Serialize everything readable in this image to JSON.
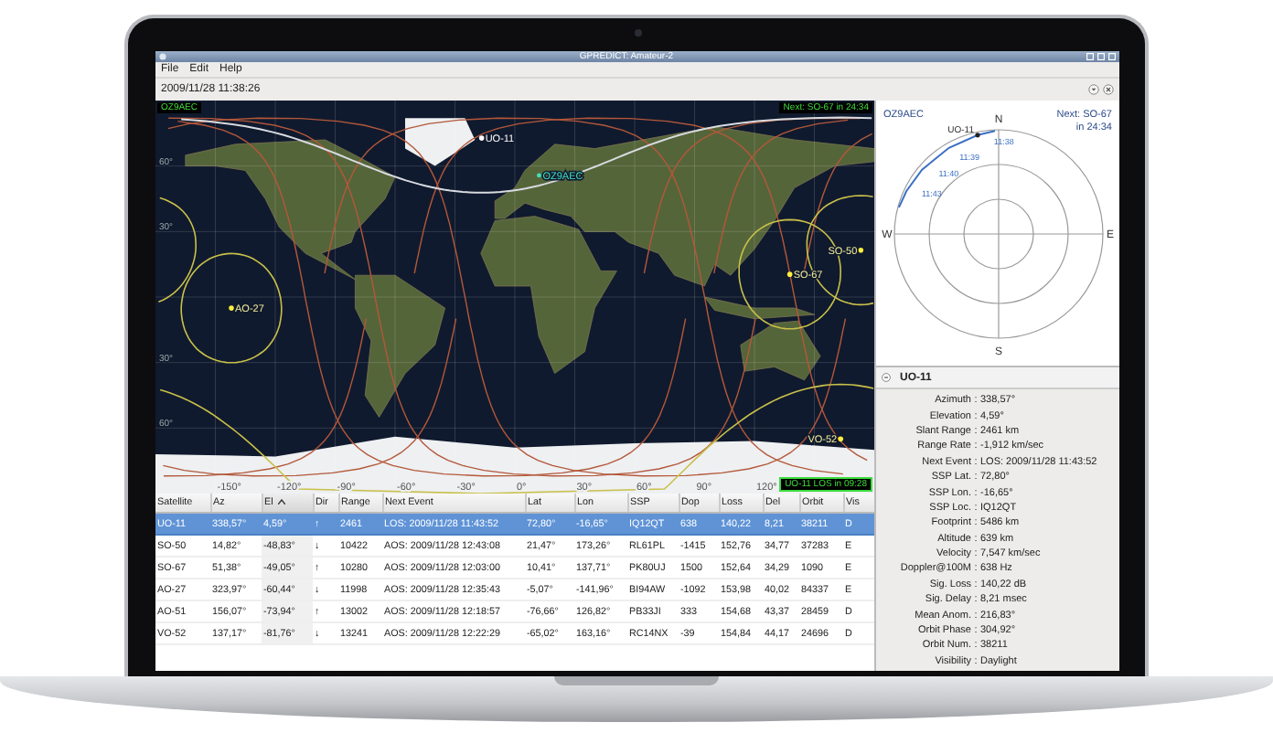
{
  "window": {
    "title": "GPREDICT: Amateur-2"
  },
  "menu": [
    {
      "label": "File"
    },
    {
      "label": "Edit"
    },
    {
      "label": "Help"
    }
  ],
  "clock": "2009/11/28 11:38:26",
  "map": {
    "station_badge": "OZ9AEC",
    "next_event": "Next: SO-67 in 24:34",
    "los_info": "UO-11 LOS in 09:28",
    "station": "OZ9AEC",
    "lat_labels": [
      "60°",
      "30°",
      "30°",
      "60°"
    ],
    "lon_labels": [
      "-150°",
      "-120°",
      "-90°",
      "-60°",
      "-30°",
      "0°",
      "30°",
      "60°",
      "90°",
      "120°"
    ],
    "satellites": [
      {
        "name": "UO-11",
        "selected": true
      },
      {
        "name": "AO-27",
        "selected": false
      },
      {
        "name": "SO-67",
        "selected": false
      },
      {
        "name": "SO-50",
        "selected": false
      },
      {
        "name": "VO-52",
        "selected": false
      }
    ]
  },
  "table": {
    "columns": [
      {
        "label": "Satellite",
        "sorted": false
      },
      {
        "label": "Az",
        "sorted": false
      },
      {
        "label": "El",
        "sorted": true
      },
      {
        "label": "Dir",
        "sorted": false
      },
      {
        "label": "Range",
        "sorted": false
      },
      {
        "label": "Next Event",
        "sorted": false
      },
      {
        "label": "Lat",
        "sorted": false
      },
      {
        "label": "Lon",
        "sorted": false
      },
      {
        "label": "SSP",
        "sorted": false
      },
      {
        "label": "Dop",
        "sorted": false
      },
      {
        "label": "Loss",
        "sorted": false
      },
      {
        "label": "Del",
        "sorted": false
      },
      {
        "label": "Orbit",
        "sorted": false
      },
      {
        "label": "Vis",
        "sorted": false
      }
    ],
    "rows": [
      {
        "selected": true,
        "cells": [
          "UO-11",
          "338,57°",
          "4,59°",
          "↑",
          "2461",
          "LOS: 2009/11/28 11:43:52",
          "72,80°",
          "-16,65°",
          "IQ12QT",
          "638",
          "140,22",
          "8,21",
          "38211",
          "D"
        ]
      },
      {
        "selected": false,
        "cells": [
          "SO-50",
          "14,82°",
          "-48,83°",
          "↓",
          "10422",
          "AOS: 2009/11/28 12:43:08",
          "21,47°",
          "173,26°",
          "RL61PL",
          "-1415",
          "152,76",
          "34,77",
          "37283",
          "E"
        ]
      },
      {
        "selected": false,
        "cells": [
          "SO-67",
          "51,38°",
          "-49,05°",
          "↑",
          "10280",
          "AOS: 2009/11/28 12:03:00",
          "10,41°",
          "137,71°",
          "PK80UJ",
          "1500",
          "152,64",
          "34,29",
          "1090",
          "E"
        ]
      },
      {
        "selected": false,
        "cells": [
          "AO-27",
          "323,97°",
          "-60,44°",
          "↓",
          "11998",
          "AOS: 2009/11/28 12:35:43",
          "-5,07°",
          "-141,96°",
          "BI94AW",
          "-1092",
          "153,98",
          "40,02",
          "84337",
          "E"
        ]
      },
      {
        "selected": false,
        "cells": [
          "AO-51",
          "156,07°",
          "-73,94°",
          "↑",
          "13002",
          "AOS: 2009/11/28 12:18:57",
          "-76,66°",
          "126,82°",
          "PB33JI",
          "333",
          "154,68",
          "43,37",
          "28459",
          "D"
        ]
      },
      {
        "selected": false,
        "cells": [
          "VO-52",
          "137,17°",
          "-81,76°",
          "↓",
          "13241",
          "AOS: 2009/11/28 12:22:29",
          "-65,02°",
          "163,16°",
          "RC14NX",
          "-39",
          "154,84",
          "44,17",
          "24696",
          "D"
        ]
      }
    ]
  },
  "polar": {
    "station": "OZ9AEC",
    "next": "Next: SO-67",
    "next_time": "in 24:34",
    "compass": [
      "N",
      "E",
      "S",
      "W"
    ],
    "time_labels": [
      "11:38",
      "11:39",
      "11:40",
      "11:43"
    ],
    "satellite": "UO-11"
  },
  "details": {
    "title": "UO-11",
    "separator": ":",
    "rows": [
      {
        "label": "Azimuth",
        "value": "338,57°"
      },
      {
        "label": "Elevation",
        "value": "4,59°"
      },
      {
        "label": "Slant Range",
        "value": "2461 km"
      },
      {
        "label": "Range Rate",
        "value": "-1,912 km/sec"
      },
      {
        "label": "Next Event",
        "value": "LOS: 2009/11/28 11:43:52"
      },
      {
        "label": "SSP Lat.",
        "value": "72,80°"
      },
      {
        "label": "SSP Lon.",
        "value": "-16,65°"
      },
      {
        "label": "SSP Loc.",
        "value": "IQ12QT"
      },
      {
        "label": "Footprint",
        "value": "5486 km"
      },
      {
        "label": "Altitude",
        "value": "639 km"
      },
      {
        "label": "Velocity",
        "value": "7,547 km/sec"
      },
      {
        "label": "Doppler@100M",
        "value": "638 Hz"
      },
      {
        "label": "Sig. Loss",
        "value": "140,22 dB"
      },
      {
        "label": "Sig. Delay",
        "value": "8,21 msec"
      },
      {
        "label": "Mean Anom.",
        "value": "216,83°"
      },
      {
        "label": "Orbit Phase",
        "value": "304,92°"
      },
      {
        "label": "Orbit Num.",
        "value": "38211"
      },
      {
        "label": "Visibility",
        "value": "Daylight"
      }
    ]
  }
}
